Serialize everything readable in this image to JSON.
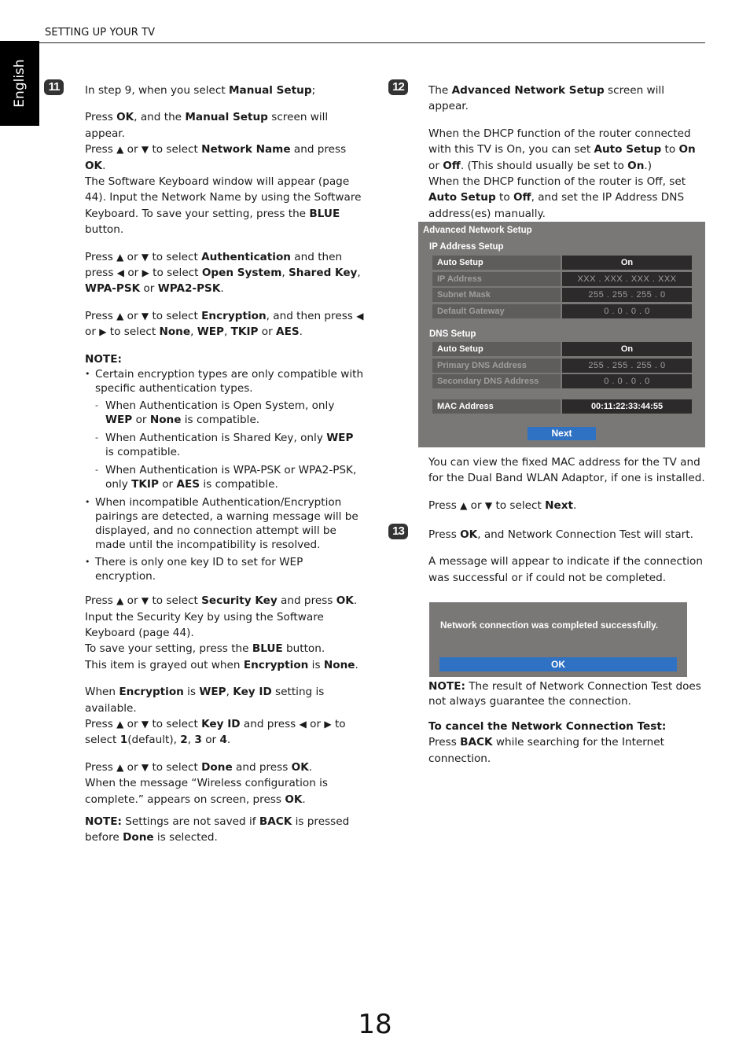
{
  "header": {
    "section_title": "SETTING UP YOUR TV",
    "language_tab": "English"
  },
  "page_number": "18",
  "icons": {
    "up": "▲",
    "down": "▼",
    "left": "◀",
    "right": "▶"
  },
  "step11": {
    "badge": "11",
    "intro": [
      "In step 9, when you select ",
      "Manual Setup",
      ";"
    ],
    "p1": {
      "l1": [
        "Press ",
        "OK",
        ", and the ",
        "Manual Setup",
        " screen will appear."
      ],
      "l2": [
        "Press ",
        " or ",
        " to select ",
        "Network Name",
        " and press ",
        "OK",
        "."
      ],
      "l3": "The Software Keyboard window will appear (page 44). Input the Network Name by using the Software Keyboard. To save your setting, press the ",
      "l3_bold": "BLUE",
      "l3_end": " button."
    },
    "p2": [
      "Press ",
      " or ",
      " to select ",
      "Authentication",
      " and then press ",
      " or ",
      " to select ",
      "Open System",
      ", ",
      "Shared Key",
      ", ",
      "WPA-PSK",
      " or ",
      "WPA2-PSK",
      "."
    ],
    "p3": [
      "Press ",
      " or ",
      " to select ",
      "Encryption",
      ", and then press ",
      " or ",
      " to select ",
      "None",
      ", ",
      "WEP",
      ", ",
      "TKIP",
      " or ",
      "AES",
      "."
    ],
    "note_heading": "NOTE:",
    "note_bullets": {
      "b1": "Certain encryption types are only compatible with specific authentication types.",
      "d1": [
        "When Authentication is Open System, only ",
        "WEP",
        " or ",
        "None",
        " is compatible."
      ],
      "d2": [
        "When Authentication is Shared Key, only ",
        "WEP",
        " is compatible."
      ],
      "d3": [
        "When Authentication is WPA-PSK or WPA2-PSK, only ",
        "TKIP",
        " or ",
        "AES",
        " is compatible."
      ],
      "b2": "When incompatible Authentication/Encryption pairings are detected, a warning message will be displayed, and no connection attempt will be made until the incompatibility is resolved.",
      "b3": "There is only one key ID to set for WEP encryption."
    },
    "p4": {
      "l1": [
        "Press ",
        " or ",
        " to select ",
        "Security Key",
        " and press ",
        "OK",
        "."
      ],
      "l2": "Input the Security Key by using the Software Keyboard (page 44).",
      "l3": [
        "To save your setting, press the ",
        "BLUE",
        " button."
      ],
      "l4": [
        "This item is grayed out when ",
        "Encryption",
        " is ",
        "None",
        "."
      ]
    },
    "p5": {
      "l1": [
        "When ",
        "Encryption",
        " is ",
        "WEP",
        ", ",
        "Key ID",
        " setting is available."
      ],
      "l2": [
        "Press ",
        " or ",
        " to select ",
        "Key ID",
        " and press ",
        " or ",
        " to select ",
        "1",
        "(default), ",
        "2",
        ", ",
        "3",
        " or ",
        "4",
        "."
      ]
    },
    "p6": {
      "l1": [
        "Press ",
        " or ",
        " to select ",
        "Done",
        " and press ",
        "OK",
        "."
      ],
      "l2": [
        "When the message “Wireless configuration is complete.” appears on screen, press ",
        "OK",
        "."
      ]
    },
    "p7": [
      "NOTE:",
      " Settings are not saved if ",
      "BACK",
      " is pressed before ",
      "Done",
      " is selected."
    ]
  },
  "step12": {
    "badge": "12",
    "intro": [
      "The ",
      "Advanced Network Setup",
      " screen will appear."
    ],
    "p1": [
      "When the DHCP function of the router connected with this TV is On, you can set ",
      "Auto Setup",
      " to ",
      "On",
      " or ",
      "Off",
      ". (This should usually be set to ",
      "On",
      ".)"
    ],
    "p2": [
      "When the DHCP function of the router is Off, set ",
      "Auto Setup",
      " to ",
      "Off",
      ", and set the IP Address DNS address(es) manually."
    ],
    "osd": {
      "title": "Advanced Network Setup",
      "ip_section": "IP Address Setup",
      "ip_rows": [
        {
          "label": "Auto Setup",
          "value": "On"
        },
        {
          "label": "IP Address",
          "value": "XXX . XXX . XXX . XXX"
        },
        {
          "label": "Subnet Mask",
          "value": "255 . 255 . 255 .   0"
        },
        {
          "label": "Default Gateway",
          "value": "0   .   0   .   0   .   0"
        }
      ],
      "dns_section": "DNS Setup",
      "dns_rows": [
        {
          "label": "Auto Setup",
          "value": "On"
        },
        {
          "label": "Primary DNS Address",
          "value": "255 . 255 . 255 .   0"
        },
        {
          "label": "Secondary DNS Address",
          "value": "0   .   0   .   0   .   0"
        }
      ],
      "mac": {
        "label": "MAC Address",
        "value": "00:11:22:33:44:55"
      },
      "next_button": "Next",
      "accent": "#2f72c4"
    },
    "p3": "You can view the fixed MAC address for the TV and for the Dual Band WLAN Adaptor, if one is installed.",
    "p4": [
      "Press ",
      " or ",
      " to select ",
      "Next",
      "."
    ]
  },
  "step13": {
    "badge": "13",
    "intro": [
      "Press ",
      "OK",
      ", and Network Connection Test will start."
    ],
    "p1": "A message will appear to indicate if the connection was successful or if could not be completed.",
    "dialog": {
      "message": "Network connection was completed successfully.",
      "ok_button": "OK"
    },
    "note": [
      "NOTE:",
      " The result of Network Connection Test does not always guarantee the connection."
    ],
    "cancel_heading": "To cancel the Network Connection Test:",
    "cancel": [
      "Press ",
      "BACK",
      " while searching for the Internet connection."
    ]
  }
}
